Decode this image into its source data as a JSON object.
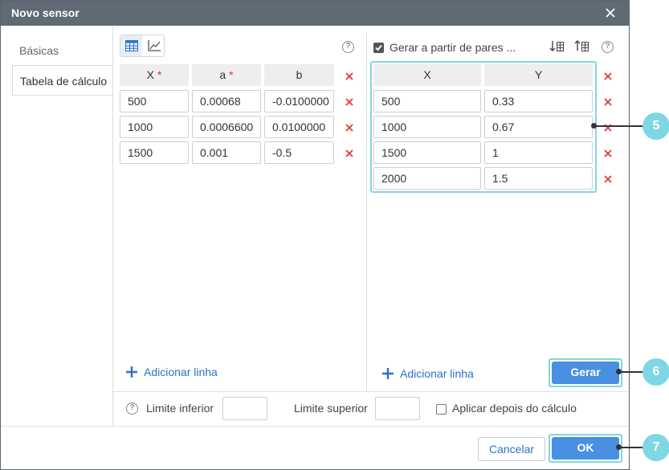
{
  "dialog": {
    "title": "Novo sensor"
  },
  "sidebar": {
    "tabs": [
      {
        "label": "Básicas"
      },
      {
        "label": "Tabela de cálculo"
      }
    ]
  },
  "left_table": {
    "headers": [
      {
        "label": "X"
      },
      {
        "label": "a"
      },
      {
        "label": "b"
      }
    ],
    "required_mark": "*",
    "rows": [
      [
        "500",
        "0.00068",
        "-0.0100000"
      ],
      [
        "1000",
        "0.0006600",
        "0.0100000"
      ],
      [
        "1500",
        "0.001",
        "-0.5"
      ]
    ],
    "add_line": "Adicionar linha"
  },
  "right_panel": {
    "generate_checkbox_label": "Gerar a partir de pares ...",
    "generate_checked": true,
    "headers": [
      {
        "label": "X"
      },
      {
        "label": "Y"
      }
    ],
    "rows": [
      [
        "500",
        "0.33"
      ],
      [
        "1000",
        "0.67"
      ],
      [
        "1500",
        "1"
      ],
      [
        "2000",
        "1.5"
      ]
    ],
    "add_line": "Adicionar linha",
    "generate_button": "Gerar"
  },
  "bounds": {
    "lower_label": "Limite inferior",
    "upper_label": "Limite superior",
    "apply_after_label": "Aplicar depois do cálculo",
    "apply_after_checked": false
  },
  "footer": {
    "cancel": "Cancelar",
    "ok": "OK"
  },
  "callouts": [
    "5",
    "6",
    "7"
  ],
  "colors": {
    "titlebar": "#5f6a75",
    "accent": "#4a90e2",
    "highlight": "#7fd7e4",
    "delete": "#e53935",
    "link": "#2b73c4"
  }
}
